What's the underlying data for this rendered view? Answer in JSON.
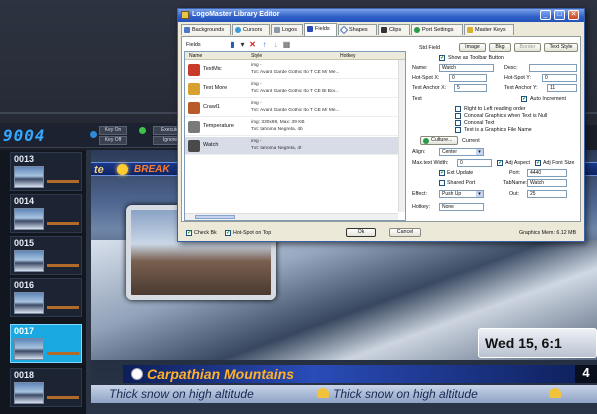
{
  "background": {
    "counter": "9004",
    "buttons": {
      "key_on": "Key On",
      "key_off": "Key Off",
      "execute": "Execute",
      "ignore": "Ignore"
    },
    "thumbnails": [
      "0013",
      "0014",
      "0015",
      "0016",
      "0017",
      "0018"
    ],
    "active_thumbnail": "0017",
    "ticker_top_left": "te",
    "ticker_top_text": "BREAK",
    "clock": "Wed 15, 6:1",
    "title_text": "Carpathian Mountains",
    "title_number": "4",
    "crawl_1": "Thick snow on high altitude",
    "crawl_2": "Thick snow on high altitude"
  },
  "dialog": {
    "title": "LogoMaster Library Editor",
    "window_buttons": {
      "minimize": "_",
      "maximize": "□",
      "close": "✕"
    },
    "tabs": [
      "Backgrounds",
      "Cursors",
      "Logos",
      "Fields",
      "Shapes",
      "Clips",
      "Port Settings",
      "Master Keys"
    ],
    "selected_tab": "Fields",
    "list": {
      "toolbar_label": "Fields",
      "columns": [
        "Name",
        "Style",
        "Hotkey"
      ],
      "rows": [
        {
          "name": "TextMic",
          "style_1": "img -",
          "style_2": "Txt: Avant Garde Gothic Ito T CE M/ Me...",
          "icon_color": "#c83a2a"
        },
        {
          "name": "Text More",
          "style_1": "img -",
          "style_2": "Txt: Avant Garde Gothic Ito T CE Bl Boi...",
          "icon_color": "#d8a030"
        },
        {
          "name": "Crawl1",
          "style_1": "img -",
          "style_2": "Txt: Avant Garde Gothic Ito T CE M/ Me...",
          "icon_color": "#b85a2a"
        },
        {
          "name": "Temperature",
          "style_1": "img: 330x98, Max: 39 KB",
          "style_2": "Txt: tahoma Negreta, 4b",
          "icon_color": "#7a7a7a"
        },
        {
          "name": "Watch",
          "style_1": "img -",
          "style_2": "Txt: tahoma Negreta, 4f",
          "icon_color": "#4a4a4a"
        }
      ],
      "selected_row": "Watch"
    },
    "props": {
      "std_field": "Std Field",
      "btn_image": "Image",
      "btn_bkg": "Bkg",
      "btn_border": "Border",
      "btn_text_style": "Text Style",
      "show_toolbar": "Show as Toolbar Button",
      "name_label": "Name:",
      "name_value": "Watch",
      "desc_label": "Desc:",
      "desc_value": "",
      "hotspot_x_label": "Hot-Spot X:",
      "hotspot_x_value": "0",
      "hotspot_y_label": "Hot-Spot Y:",
      "hotspot_y_value": "0",
      "text_anchor_x_label": "Text Anchor X:",
      "text_anchor_x_value": "5",
      "text_anchor_y_label": "Text Anchor Y:",
      "text_anchor_y_value": "11",
      "text_label": "Text",
      "auto_increment": "Auto Increment",
      "opt_rtl": "Right to Left reading order",
      "opt_conceal_graphics": "Conceal Graphics when Text is Null",
      "opt_conceal_text": "Conceal Text",
      "opt_graphics_file": "Text is a Graphics File Name",
      "culture_btn": "Culture...",
      "culture_value": "Current",
      "align_label": "Align:",
      "align_value": "Center",
      "max_text_width_label": "Max.text Width:",
      "max_text_width_value": "0",
      "adj_aspect": "Adj Aspect",
      "adj_font_size": "Adj Font Size",
      "ext_update": "Ext Update",
      "port_label": "Port:",
      "port_value": "4440",
      "shared_port": "Shared Port",
      "tab_name_label": "TabName:",
      "tab_name_value": "Watch",
      "effect_label": "Effect:",
      "effect_value": "Push Up",
      "out_label": "Out:",
      "out_value": "25",
      "hotkey_label": "Hotkey:",
      "hotkey_value": "None"
    },
    "footer": {
      "check_bk": "Check Bk",
      "hotspot_on_top": "Hot-Spot on Top",
      "ok": "Ok",
      "cancel": "Cancel",
      "graphics_mem": "Graphics Mem: 6.12 MB"
    }
  }
}
